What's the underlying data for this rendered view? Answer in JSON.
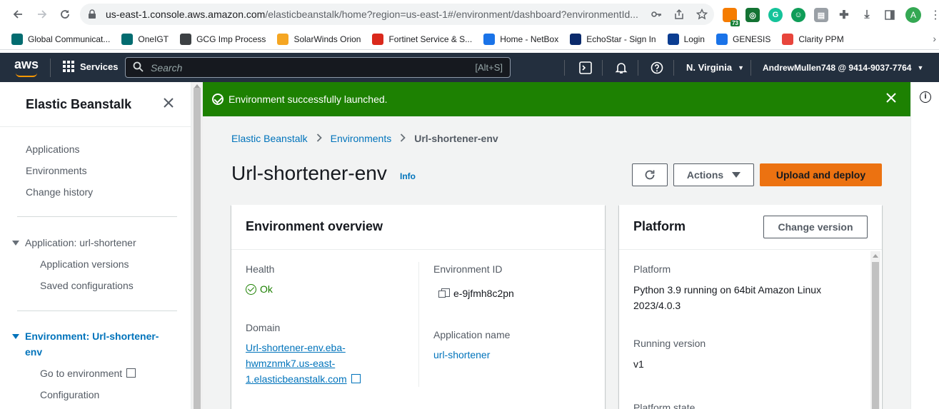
{
  "browser": {
    "url_host": "us-east-1.console.aws.amazon.com",
    "url_path": "/elasticbeanstalk/home?region=us-east-1#/environment/dashboard?environmentId...",
    "extension_badge": "73",
    "profile_initial": "A",
    "bookmarks": [
      {
        "label": "Global Communicat...",
        "icon": "sharepoint-icon",
        "color": "#036c70"
      },
      {
        "label": "OneIGT",
        "icon": "sharepoint-icon",
        "color": "#036c70"
      },
      {
        "label": "GCG Imp Process",
        "icon": "globe-icon",
        "color": "#3c4043"
      },
      {
        "label": "SolarWinds Orion",
        "icon": "solarwinds-icon",
        "color": "#f5a623"
      },
      {
        "label": "Fortinet Service & S...",
        "icon": "fortinet-icon",
        "color": "#da291c"
      },
      {
        "label": "Home - NetBox",
        "icon": "netbox-icon",
        "color": "#1a73e8"
      },
      {
        "label": "EchoStar - Sign In",
        "icon": "echostar-icon",
        "color": "#0b2a6b"
      },
      {
        "label": "Login",
        "icon": "hub-icon",
        "color": "#0b3d91"
      },
      {
        "label": "GENESIS",
        "icon": "genesis-icon",
        "color": "#1a73e8"
      },
      {
        "label": "Clarity PPM",
        "icon": "clarity-icon",
        "color": "#e8453c"
      }
    ]
  },
  "aws_nav": {
    "logo": "aws",
    "services": "Services",
    "search_placeholder": "Search",
    "search_shortcut": "[Alt+S]",
    "region": "N. Virginia",
    "account": "AndrewMullen748 @ 9414-9037-7764"
  },
  "sidebar": {
    "title": "Elastic Beanstalk",
    "items": [
      "Applications",
      "Environments",
      "Change history"
    ],
    "application_section": "Application: url-shortener",
    "application_items": [
      "Application versions",
      "Saved configurations"
    ],
    "environment_section": "Environment: Url-shortener-env",
    "environment_items": [
      "Go to environment",
      "Configuration"
    ]
  },
  "flash": {
    "message": "Environment successfully launched.",
    "color": "#1d8102"
  },
  "breadcrumb": [
    "Elastic Beanstalk",
    "Environments",
    "Url-shortener-env"
  ],
  "page": {
    "title": "Url-shortener-env",
    "info": "Info",
    "actions_label": "Actions",
    "upload_label": "Upload and deploy",
    "accent": "#ec7211"
  },
  "overview": {
    "heading": "Environment overview",
    "health_label": "Health",
    "health_value": "Ok",
    "domain_label": "Domain",
    "domain_lines": [
      "Url-shortener-env.eba-",
      "hwmznmk7.us-east-",
      "1.elasticbeanstalk.com"
    ],
    "env_id_label": "Environment ID",
    "env_id_value": "e-9jfmh8c2pn",
    "app_name_label": "Application name",
    "app_name_value": "url-shortener"
  },
  "platform": {
    "heading": "Platform",
    "change_version": "Change version",
    "platform_label": "Platform",
    "platform_lines": [
      "Python 3.9 running on 64bit Amazon Linux",
      "2023/4.0.3"
    ],
    "running_version_label": "Running version",
    "running_version_value": "v1",
    "platform_state_label": "Platform state"
  }
}
